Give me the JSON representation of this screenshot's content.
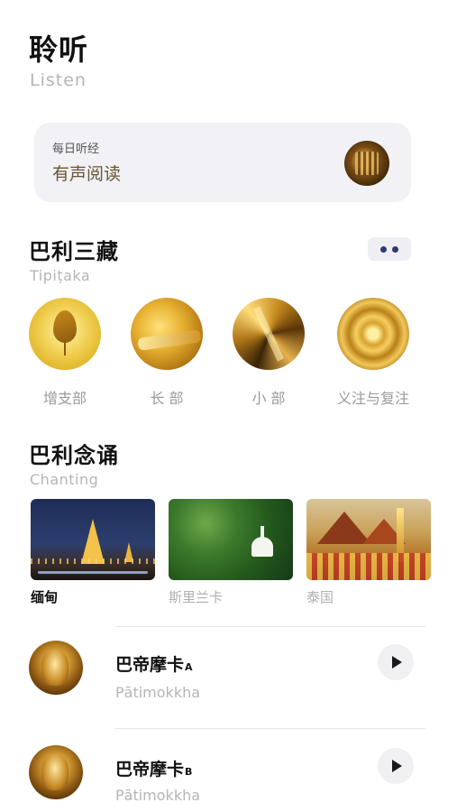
{
  "header": {
    "title": "聆听",
    "subtitle": "Listen"
  },
  "daily_card": {
    "small_label": "每日听经",
    "title": "有声阅读",
    "thumb_icon": "scripture-thumbnail"
  },
  "tipitaka": {
    "title": "巴利三藏",
    "subtitle": "Tipiṭaka",
    "more_icon": "more-dots-icon",
    "items": [
      {
        "label": "增支部",
        "icon": "bodhi-leaf"
      },
      {
        "label": "长 部",
        "icon": "golden-buddha"
      },
      {
        "label": "小 部",
        "icon": "golden-rays"
      },
      {
        "label": "义注与复注",
        "icon": "golden-ornament"
      }
    ]
  },
  "chanting": {
    "title": "巴利念诵",
    "subtitle": "Chanting",
    "regions": [
      {
        "label": "缅甸",
        "active": true
      },
      {
        "label": "斯里兰卡",
        "active": false
      },
      {
        "label": "泰国",
        "active": false
      }
    ]
  },
  "tracks": [
    {
      "title": "巴帝摩卡",
      "sup": "A",
      "subtitle": "Pātimokkha"
    },
    {
      "title": "巴帝摩卡",
      "sup": "B",
      "subtitle": "Pātimokkha"
    }
  ],
  "colors": {
    "accent_navy": "#2e3a6e",
    "gold_text": "#6a5530",
    "muted": "#b5b5b5"
  }
}
